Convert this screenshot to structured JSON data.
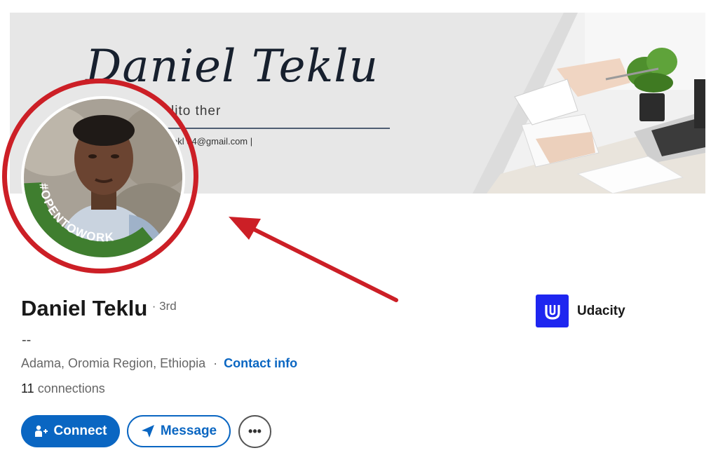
{
  "banner": {
    "title": "Daniel Teklu",
    "subtitle": "lito ther",
    "email": "ekl 34@gmail.com  |"
  },
  "avatar": {
    "frame_text": "#OPENTOWORK",
    "frame_color": "#3f7e2f"
  },
  "profile": {
    "name": "Daniel Teklu",
    "degree": "· 3rd",
    "headline": "--",
    "location": "Adama, Oromia Region, Ethiopia",
    "separator": "·",
    "contact_link": "Contact info",
    "connections_count": "11",
    "connections_label": "connections"
  },
  "company": {
    "name": "Udacity",
    "logo_color": "#1e26f0"
  },
  "actions": {
    "connect_label": "Connect",
    "message_label": "Message",
    "more_label": "•••"
  },
  "annotation": {
    "color": "#cc1f26"
  },
  "colors": {
    "primary": "#0a66c2",
    "text": "#191919",
    "muted": "#666666"
  }
}
